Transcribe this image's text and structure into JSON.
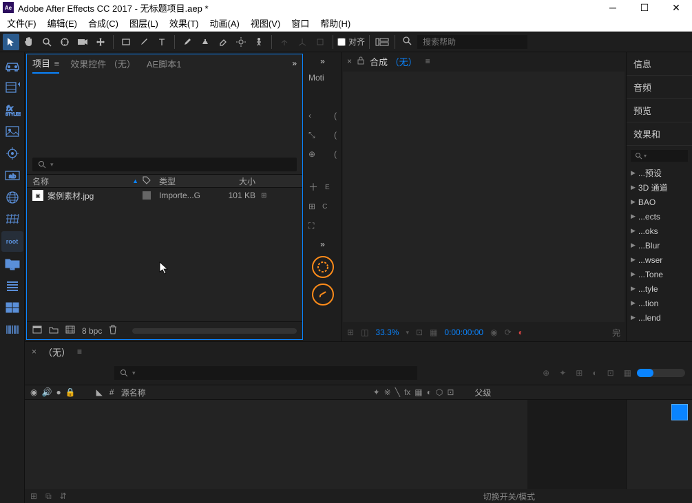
{
  "title": "Adobe After Effects CC 2017 - 无标题项目.aep *",
  "menus": [
    "文件(F)",
    "编辑(E)",
    "合成(C)",
    "图层(L)",
    "效果(T)",
    "动画(A)",
    "视图(V)",
    "窗口",
    "帮助(H)"
  ],
  "toolbar": {
    "align": "对齐",
    "searchPlaceholder": "搜索帮助"
  },
  "project": {
    "tabProject": "项目",
    "tabEffectControls": "效果控件 （无）",
    "tabScript": "AE脚本1",
    "cols": {
      "name": "名称",
      "type": "类型",
      "size": "大小"
    },
    "rows": [
      {
        "name": "案例素材.jpg",
        "type": "Importe...G",
        "size": "101 KB"
      }
    ],
    "bpc": "8 bpc"
  },
  "midStrip": {
    "motion": "Moti"
  },
  "comp": {
    "label": "合成",
    "none": "（无）",
    "zoom": "33.3%",
    "time": "0:00:00:00",
    "status": "完"
  },
  "rightPanels": {
    "info": "信息",
    "audio": "音频",
    "preview": "预览",
    "effects": "效果和",
    "list": [
      "...预设",
      "3D 通道",
      "BAO",
      "...ects",
      "...oks",
      "...Blur",
      "...wser",
      "...Tone",
      "...tyle",
      "...tion",
      "...lend"
    ]
  },
  "timeline": {
    "none": "（无）",
    "srcName": "源名称",
    "parent": "父级",
    "switchMode": "切换开关/模式"
  }
}
